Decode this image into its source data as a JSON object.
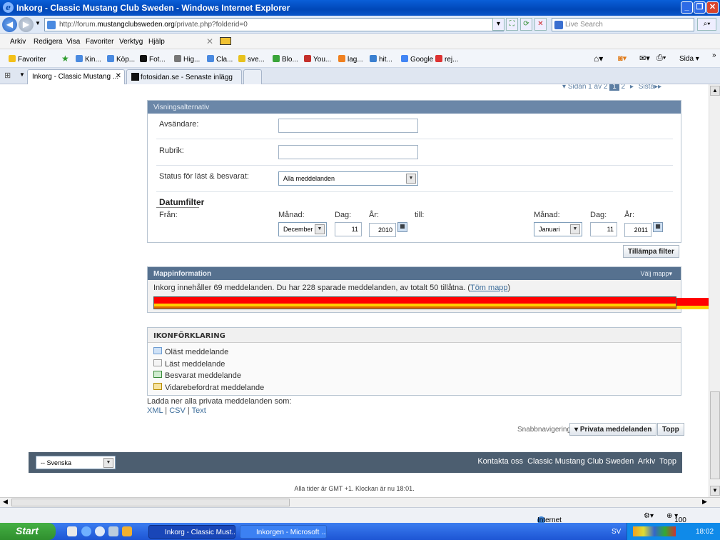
{
  "window": {
    "title": "Inkorg - Classic Mustang Club Sweden - Windows Internet Explorer"
  },
  "browser": {
    "url_prefix": "http://forum.",
    "url_domain": "mustangclubsweden.org",
    "url_path": "/private.php?folderid=0",
    "search_placeholder": "Live Search",
    "menu": [
      "Arkiv",
      "Redigera",
      "Visa",
      "Favoriter",
      "Verktyg",
      "Hjälp"
    ],
    "favorites_label": "Favoriter",
    "favorites": [
      "Kin...",
      "Köp...",
      "Fot...",
      "Hig...",
      "Cla...",
      "sve...",
      "Blo...",
      "You...",
      "lag...",
      "hit...",
      "Google",
      "rej..."
    ],
    "sida_label": "Sida",
    "tabs": [
      "Inkorg - Classic Mustang ...",
      "fotosidan.se - Senaste inlägg"
    ]
  },
  "pagination": {
    "label": "Sidan 1 av 2",
    "pages": [
      "1",
      "2"
    ],
    "last": "Sista"
  },
  "filter": {
    "header": "Visningsalternativ",
    "sender_label": "Avsändare:",
    "subject_label": "Rubrik:",
    "status_label": "Status för läst & besvarat:",
    "status_value": "Alla meddelanden",
    "date_heading": "Datumfilter",
    "from_label": "Från:",
    "month_label": "Månad:",
    "day_label": "Dag:",
    "year_label": "År:",
    "to_label": "till:",
    "from_month": "December",
    "from_day": "11",
    "from_year": "2010",
    "to_month": "Januari",
    "to_day": "11",
    "to_year": "2011",
    "apply_button": "Tillämpa filter"
  },
  "folder": {
    "header": "Mappinformation",
    "choose_label": "Välj mapp",
    "info": "Inkorg innehåller 69 meddelanden. Du har 228 sparade meddelanden, av totalt 50 tillåtna. (",
    "empty_link": "Töm mapp",
    "info_end": ")",
    "quota_fraction": 1.0,
    "quota_color": "#ff0000"
  },
  "legend": {
    "header": "IKONFÖRKLARING",
    "items": [
      "Oläst meddelande",
      "Läst meddelande",
      "Besvarat meddelande",
      "Vidarebefordrat meddelande"
    ]
  },
  "download": {
    "label": "Ladda ner alla privata meddelanden som:",
    "xml": "XML",
    "csv": "CSV",
    "text": "Text",
    "sep": "|"
  },
  "quicknav": {
    "label": "Snabbnavigering",
    "pm_button": "Privata meddelanden",
    "top_button": "Topp"
  },
  "footer": {
    "language": "-- Svenska",
    "links": [
      "Kontakta oss",
      "Classic Mustang Club Sweden",
      "Arkiv",
      "Topp"
    ],
    "timezone": "Alla tider är GMT +1. Klockan är nu 18:01."
  },
  "status": {
    "zone": "Internet",
    "zoom": "100 %"
  },
  "taskbar": {
    "start": "Start",
    "tasks": [
      "Inkorg - Classic Must...",
      "Inkorgen - Microsoft ..."
    ],
    "lang": "SV",
    "clock": "18:02"
  }
}
